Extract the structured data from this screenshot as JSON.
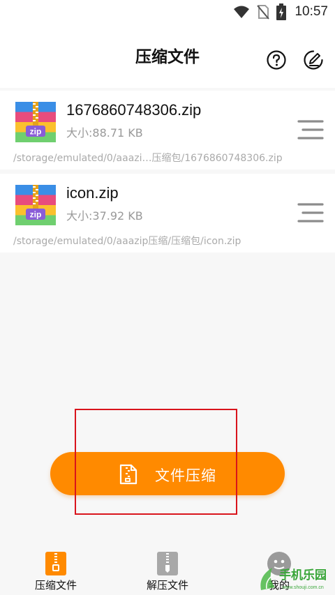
{
  "status_bar": {
    "time": "10:57",
    "icons": [
      "wifi-icon",
      "no-sim-icon",
      "battery-charging-icon"
    ]
  },
  "header": {
    "title": "压缩文件",
    "help_icon": "question-circle-icon",
    "edit_icon": "edit-circle-icon"
  },
  "files": [
    {
      "name": "1676860748306.zip",
      "size": "大小:88.71 KB",
      "path": "/storage/emulated/0/aaazi…压缩包/1676860748306.zip",
      "icon_label": "zip"
    },
    {
      "name": "icon.zip",
      "size": "大小:37.92 KB",
      "path": "/storage/emulated/0/aaazip压缩/压缩包/icon.zip",
      "icon_label": "zip"
    }
  ],
  "action_button": {
    "label": "文件压缩",
    "icon": "zip-file-icon"
  },
  "bottom_nav": {
    "items": [
      {
        "label": "压缩文件",
        "icon": "compress-tab-icon",
        "active": true
      },
      {
        "label": "解压文件",
        "icon": "extract-tab-icon",
        "active": false
      },
      {
        "label": "我的",
        "icon": "profile-tab-icon",
        "active": false
      }
    ]
  },
  "watermark": {
    "text": "手机乐园",
    "subtext": "www.shouji.com.cn"
  },
  "colors": {
    "accent": "#ff8a00",
    "highlight": "#d9141c",
    "muted_text": "#999999",
    "background": "#f7f7f7"
  }
}
